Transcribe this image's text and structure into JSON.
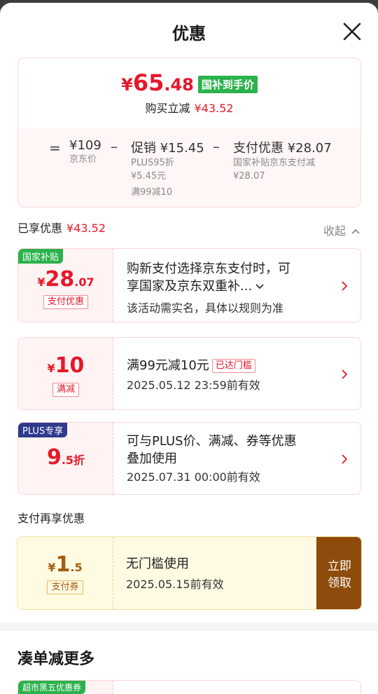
{
  "header": {
    "title": "优惠"
  },
  "summary": {
    "price_yen": "¥",
    "price_int": "65",
    "price_dec": ".48",
    "price_tag": "国补到手价",
    "save_label": "购买立减",
    "save_amount": "¥43.52",
    "equals": "=",
    "minus": "–",
    "jd_price": "¥109",
    "jd_price_label": "京东价",
    "promo_label": "促销 ¥15.45",
    "promo_line1": "PLUS95折",
    "promo_line2": "¥5.45元",
    "promo_line3": "满99减10",
    "pay_label": "支付优惠 ¥28.07",
    "pay_line1": "国家补贴京东支付减",
    "pay_line2": "¥28.07"
  },
  "enjoyed": {
    "label": "已享优惠",
    "amount": "¥43.52",
    "collapse": "收起"
  },
  "cards": [
    {
      "badge": "国家补贴",
      "badge_color": "#2bb24c",
      "amt_small": "¥",
      "amt_big": "28",
      "amt_dec": ".07",
      "pill": "支付优惠",
      "line1": "购新支付选择京东支付时，可",
      "line2": "享国家及京东双重补...",
      "line3": "该活动需实名，具体以规则为准"
    },
    {
      "amt_small": "¥",
      "amt_big": "10",
      "pill": "满减",
      "line1": "满99元减10元",
      "tag": "已达门槛",
      "line2": "2025.05.12 23:59前有效"
    },
    {
      "badge": "PLUS专享",
      "badge_color": "#2e3a8c",
      "amt_big": "9",
      "amt_small": ".5折",
      "line1": "可与PLUS价、满减、券等优惠",
      "line2": "叠加使用",
      "line3": "2025.07.31 00:00前有效"
    }
  ],
  "pay_section": {
    "label": "支付再享优惠",
    "amt_small": "¥",
    "amt_big": "1",
    "amt_dec": ".5",
    "pill": "支付券",
    "line1": "无门槛使用",
    "line2": "2025.05.15前有效",
    "claim_line1": "立即",
    "claim_line2": "领取"
  },
  "more": {
    "title": "凑单减更多",
    "badge": "超市黑五优惠券"
  },
  "colors": {
    "accent": "#e5182a",
    "green": "#2bb24c",
    "plus": "#2e3a8c",
    "claim": "#8e4b0c"
  }
}
